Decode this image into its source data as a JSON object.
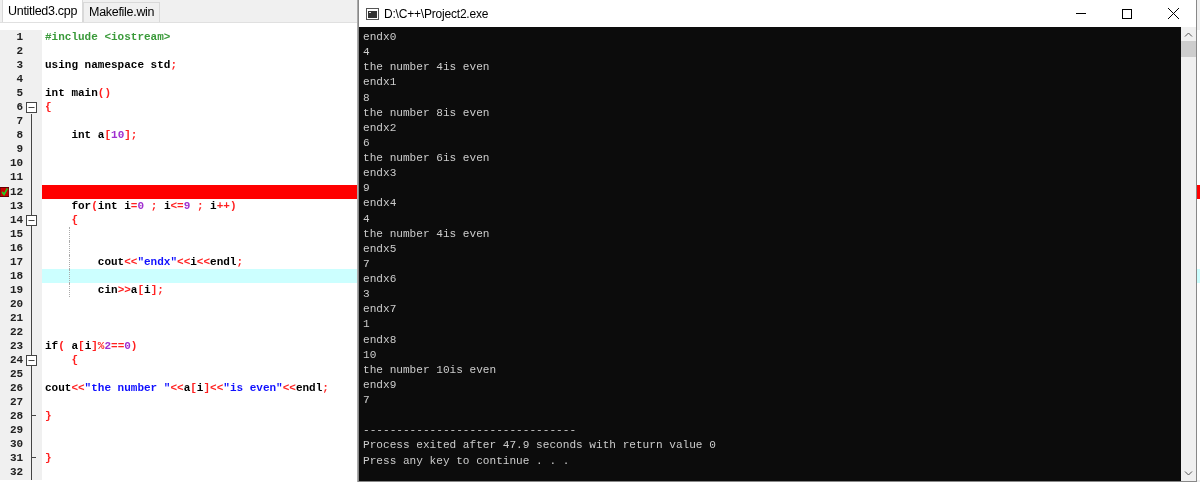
{
  "editor": {
    "tabs": [
      {
        "label": "Untitled3.cpp",
        "selected": true
      },
      {
        "label": "Makefile.win",
        "selected": false
      }
    ],
    "lines": [
      {
        "number": "1",
        "tokens": [
          {
            "kind": "pp",
            "text": "#include <iostream>"
          }
        ]
      },
      {
        "number": "2"
      },
      {
        "number": "3",
        "tokens": [
          {
            "kind": "t",
            "text": "using namespace std"
          },
          {
            "kind": "p",
            "text": ";"
          }
        ]
      },
      {
        "number": "4"
      },
      {
        "number": "5",
        "tokens": [
          {
            "kind": "t",
            "text": "int main"
          },
          {
            "kind": "p",
            "text": "()"
          }
        ]
      },
      {
        "number": "6",
        "fold_open": true,
        "tokens": [
          {
            "kind": "p",
            "text": "{"
          }
        ]
      },
      {
        "number": "7"
      },
      {
        "number": "8",
        "tokens": [
          {
            "kind": "t",
            "text": "    int a"
          },
          {
            "kind": "p",
            "text": "["
          },
          {
            "kind": "n",
            "text": "10"
          },
          {
            "kind": "p",
            "text": "];"
          }
        ]
      },
      {
        "number": "9"
      },
      {
        "number": "10"
      },
      {
        "number": "11"
      },
      {
        "number": "12",
        "breakpoint": true
      },
      {
        "number": "13",
        "tokens": [
          {
            "kind": "t",
            "text": "    for"
          },
          {
            "kind": "p",
            "text": "("
          },
          {
            "kind": "t",
            "text": "int i"
          },
          {
            "kind": "p",
            "text": "="
          },
          {
            "kind": "n",
            "text": "0"
          },
          {
            "kind": "p",
            "text": " ; "
          },
          {
            "kind": "t",
            "text": "i"
          },
          {
            "kind": "p",
            "text": "<="
          },
          {
            "kind": "n",
            "text": "9"
          },
          {
            "kind": "p",
            "text": " ; "
          },
          {
            "kind": "t",
            "text": "i"
          },
          {
            "kind": "p",
            "text": "++)"
          }
        ]
      },
      {
        "number": "14",
        "fold_open": true,
        "tokens": [
          {
            "kind": "p",
            "text": "    {"
          }
        ]
      },
      {
        "number": "15",
        "guide": true
      },
      {
        "number": "16",
        "guide": true
      },
      {
        "number": "17",
        "guide": true,
        "tokens": [
          {
            "kind": "t",
            "text": "        cout"
          },
          {
            "kind": "p",
            "text": "<<"
          },
          {
            "kind": "s",
            "text": "\"endx\""
          },
          {
            "kind": "p",
            "text": "<<"
          },
          {
            "kind": "t",
            "text": "i"
          },
          {
            "kind": "p",
            "text": "<<"
          },
          {
            "kind": "t",
            "text": "endl"
          },
          {
            "kind": "p",
            "text": ";"
          }
        ]
      },
      {
        "number": "18",
        "guide": true,
        "current_line": true
      },
      {
        "number": "19",
        "guide": true,
        "tokens": [
          {
            "kind": "t",
            "text": "        cin"
          },
          {
            "kind": "p",
            "text": ">>"
          },
          {
            "kind": "t",
            "text": "a"
          },
          {
            "kind": "p",
            "text": "["
          },
          {
            "kind": "t",
            "text": "i"
          },
          {
            "kind": "p",
            "text": "];"
          }
        ]
      },
      {
        "number": "20"
      },
      {
        "number": "21"
      },
      {
        "number": "22"
      },
      {
        "number": "23",
        "tokens": [
          {
            "kind": "t",
            "text": "if"
          },
          {
            "kind": "p",
            "text": "( "
          },
          {
            "kind": "t",
            "text": "a"
          },
          {
            "kind": "p",
            "text": "["
          },
          {
            "kind": "t",
            "text": "i"
          },
          {
            "kind": "p",
            "text": "]%"
          },
          {
            "kind": "n",
            "text": "2"
          },
          {
            "kind": "p",
            "text": "=="
          },
          {
            "kind": "n",
            "text": "0"
          },
          {
            "kind": "p",
            "text": ")"
          }
        ]
      },
      {
        "number": "24",
        "fold_open": true,
        "tokens": [
          {
            "kind": "p",
            "text": "    {"
          }
        ]
      },
      {
        "number": "25"
      },
      {
        "number": "26",
        "tokens": [
          {
            "kind": "t",
            "text": "cout"
          },
          {
            "kind": "p",
            "text": "<<"
          },
          {
            "kind": "s",
            "text": "\"the number \""
          },
          {
            "kind": "p",
            "text": "<<"
          },
          {
            "kind": "t",
            "text": "a"
          },
          {
            "kind": "p",
            "text": "["
          },
          {
            "kind": "t",
            "text": "i"
          },
          {
            "kind": "p",
            "text": "]<<"
          },
          {
            "kind": "s",
            "text": "\"is even\""
          },
          {
            "kind": "p",
            "text": "<<"
          },
          {
            "kind": "t",
            "text": "endl"
          },
          {
            "kind": "p",
            "text": ";"
          }
        ]
      },
      {
        "number": "27"
      },
      {
        "number": "28",
        "fold_end": true,
        "tokens": [
          {
            "kind": "p",
            "text": "}"
          }
        ]
      },
      {
        "number": "29"
      },
      {
        "number": "30"
      },
      {
        "number": "31",
        "fold_end": true,
        "tokens": [
          {
            "kind": "p",
            "text": "}"
          }
        ]
      },
      {
        "number": "32"
      }
    ]
  },
  "console": {
    "title": "D:\\C++\\Project2.exe",
    "output": [
      "endx0",
      "4",
      "the number 4is even",
      "endx1",
      "8",
      "the number 8is even",
      "endx2",
      "6",
      "the number 6is even",
      "endx3",
      "9",
      "endx4",
      "4",
      "the number 4is even",
      "endx5",
      "7",
      "endx6",
      "3",
      "endx7",
      "1",
      "endx8",
      "10",
      "the number 10is even",
      "endx9",
      "7"
    ],
    "summary": {
      "rule": "--------------------------------",
      "lines": [
        "Process exited after 47.9 seconds with return value 0",
        "Press any key to continue . . ."
      ]
    }
  }
}
